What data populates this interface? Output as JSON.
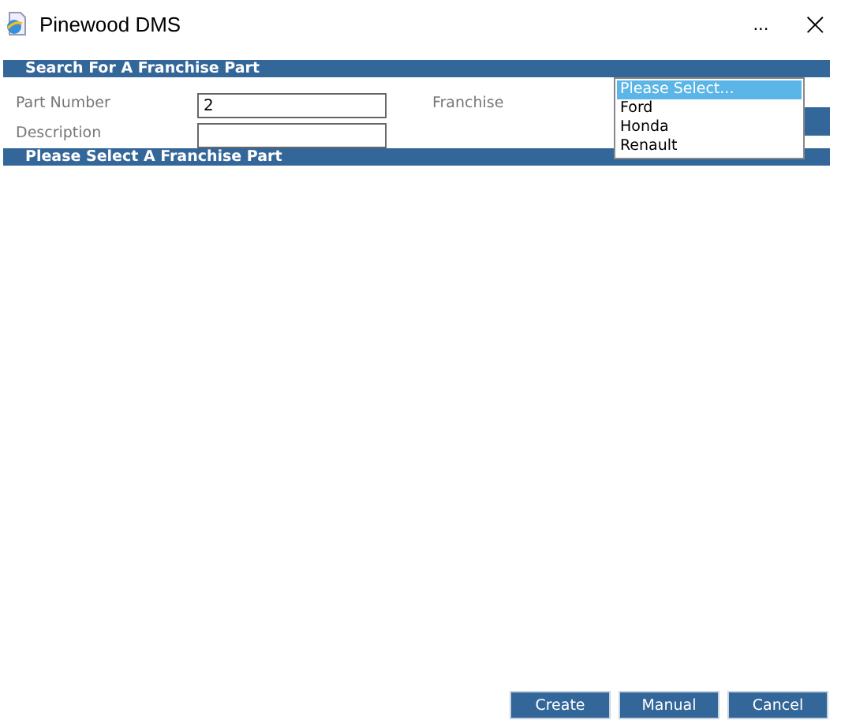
{
  "window": {
    "title": "Pinewood DMS",
    "menu": "...",
    "close": "×"
  },
  "search_section": {
    "heading": "Search For A Franchise Part",
    "part_number": {
      "label": "Part Number",
      "value": "2"
    },
    "description": {
      "label": "Description"
    },
    "franchise": {
      "label": "Franchise",
      "expanded": true,
      "options": [
        {
          "label": "Please Select...",
          "selected": true
        },
        {
          "label": "Ford",
          "selected": false
        },
        {
          "label": "Honda",
          "selected": false
        },
        {
          "label": "Renault",
          "selected": false
        }
      ]
    }
  },
  "results_section": {
    "heading": "Please Select A Franchise Part"
  },
  "buttons": [
    "Create",
    "Manual",
    "Cancel"
  ]
}
